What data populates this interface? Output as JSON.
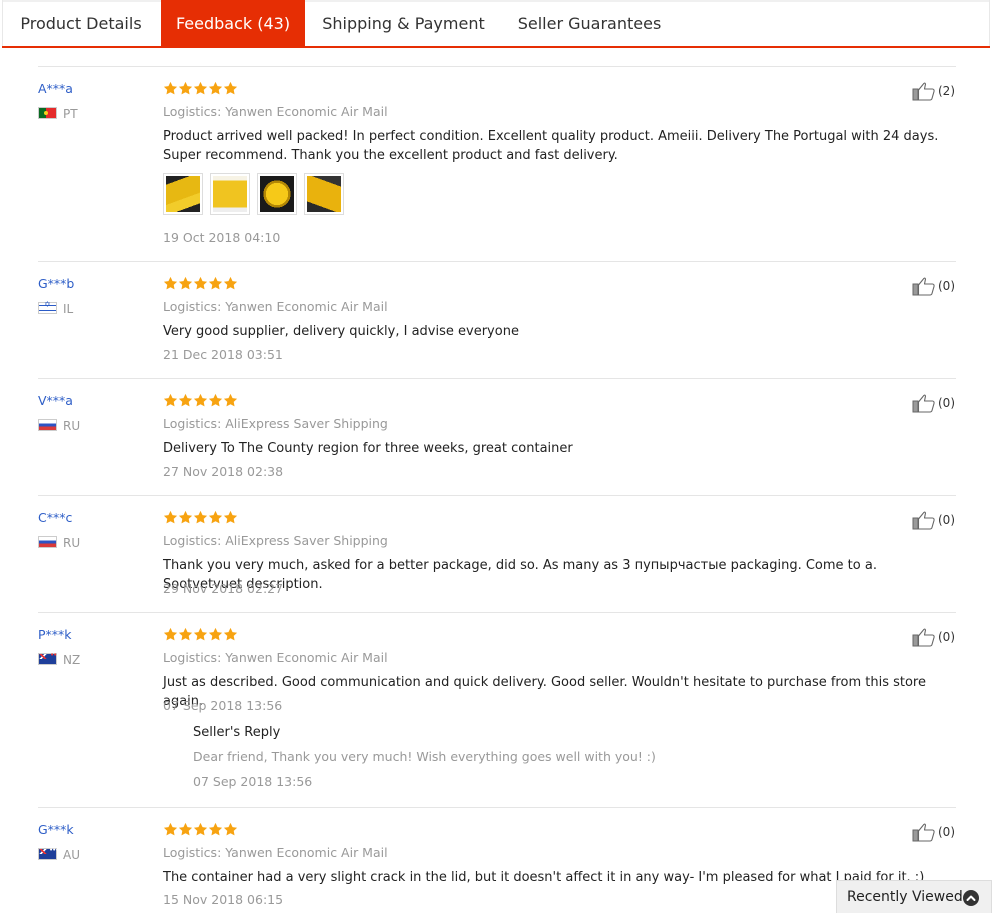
{
  "tabs": [
    {
      "label": "Product Details",
      "active": false
    },
    {
      "label": "Feedback (43)",
      "active": true
    },
    {
      "label": "Shipping & Payment",
      "active": false
    },
    {
      "label": "Seller Guarantees",
      "active": false
    }
  ],
  "colors": {
    "accent": "#e62e04",
    "star": "#f7a311",
    "user": "#2e5ec7",
    "muted": "#999999"
  },
  "reviews": [
    {
      "user": "A***a",
      "country": "PT",
      "flag_icon": "portugal-flag-icon",
      "rating": 5,
      "logistics": "Logistics: Yanwen Economic Air Mail",
      "text": "Product arrived well packed! In perfect condition. Excellent quality product. Ameiii. Delivery The Portugal with 24 days. Super recommend. Thank you the excellent product and fast delivery.",
      "date": "19 Oct 2018 04:10",
      "likes": "(2)",
      "photos": 4
    },
    {
      "user": "G***b",
      "country": "IL",
      "flag_icon": "israel-flag-icon",
      "rating": 5,
      "logistics": "Logistics: Yanwen Economic Air Mail",
      "text": "Very good supplier, delivery quickly, I advise everyone",
      "date": "21 Dec 2018 03:51",
      "likes": "(0)"
    },
    {
      "user": "V***a",
      "country": "RU",
      "flag_icon": "russia-flag-icon",
      "rating": 5,
      "logistics": "Logistics: AliExpress Saver Shipping",
      "text": "Delivery To The County region for three weeks, great container",
      "date": "27 Nov 2018 02:38",
      "likes": "(0)"
    },
    {
      "user": "C***c",
      "country": "RU",
      "flag_icon": "russia-flag-icon",
      "rating": 5,
      "logistics": "Logistics: AliExpress Saver Shipping",
      "text": "Thank you very much, asked for a better package, did so. As many as 3 пупырчастые packaging. Come to a. Sootvetvuet description.",
      "date": "29 Nov 2018 02:27",
      "likes": "(0)"
    },
    {
      "user": "P***k",
      "country": "NZ",
      "flag_icon": "new-zealand-flag-icon",
      "rating": 5,
      "logistics": "Logistics: Yanwen Economic Air Mail",
      "text": "Just as described. Good communication and quick delivery. Good seller. Wouldn't hesitate to purchase from this store again.",
      "date": "07 Sep 2018 13:56",
      "likes": "(0)",
      "reply": {
        "title": "Seller's Reply",
        "text": "Dear friend, Thank you very much! Wish everything goes well with you! :)",
        "date": "07 Sep 2018 13:56"
      }
    },
    {
      "user": "G***k",
      "country": "AU",
      "flag_icon": "australia-flag-icon",
      "rating": 5,
      "logistics": "Logistics: Yanwen Economic Air Mail",
      "text": "The container had a very slight crack in the lid, but it doesn't affect it in any way- I'm pleased for what I paid for it. :)",
      "date": "15 Nov 2018 06:15",
      "likes": "(0)"
    }
  ],
  "recently_viewed": {
    "label": "Recently Viewed",
    "icon": "chevron-up-icon"
  }
}
